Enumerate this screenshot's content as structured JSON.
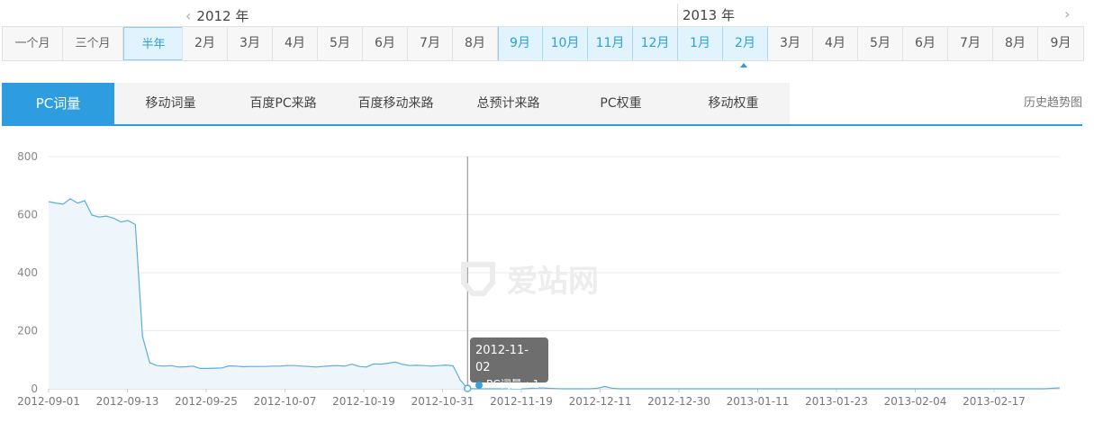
{
  "range_buttons": [
    {
      "label": "一个月",
      "active": false
    },
    {
      "label": "三个月",
      "active": false
    },
    {
      "label": "半年",
      "active": true
    }
  ],
  "years": {
    "prev": "2012 年",
    "next": "2013 年"
  },
  "months": [
    {
      "label": "2月",
      "sel": false
    },
    {
      "label": "3月",
      "sel": false
    },
    {
      "label": "4月",
      "sel": false
    },
    {
      "label": "5月",
      "sel": false
    },
    {
      "label": "6月",
      "sel": false
    },
    {
      "label": "7月",
      "sel": false
    },
    {
      "label": "8月",
      "sel": false
    },
    {
      "label": "9月",
      "sel": true
    },
    {
      "label": "10月",
      "sel": true
    },
    {
      "label": "11月",
      "sel": true
    },
    {
      "label": "12月",
      "sel": true
    },
    {
      "label": "1月",
      "sel": true
    },
    {
      "label": "2月",
      "sel": true
    },
    {
      "label": "3月",
      "sel": false
    },
    {
      "label": "4月",
      "sel": false
    },
    {
      "label": "5月",
      "sel": false
    },
    {
      "label": "6月",
      "sel": false
    },
    {
      "label": "7月",
      "sel": false
    },
    {
      "label": "8月",
      "sel": false
    },
    {
      "label": "9月",
      "sel": false
    }
  ],
  "tabs": [
    {
      "label": "PC词量",
      "active": true
    },
    {
      "label": "移动词量",
      "active": false
    },
    {
      "label": "百度PC来路",
      "active": false
    },
    {
      "label": "百度移动来路",
      "active": false
    },
    {
      "label": "总预计来路",
      "active": false
    },
    {
      "label": "PC权重",
      "active": false
    },
    {
      "label": "移动权重",
      "active": false
    }
  ],
  "history_link": "历史趋势图",
  "watermark": "爱站网",
  "tooltip": {
    "date": "2012-11-02",
    "series": "PC词量",
    "value": "1"
  },
  "colors": {
    "accent": "#2e9de0",
    "line": "#5aaee0",
    "area": "#eef5fb",
    "grid": "#ebebeb"
  },
  "chart_data": {
    "type": "area",
    "ylim": [
      0,
      800
    ],
    "yticks": [
      0,
      200,
      400,
      600,
      800
    ],
    "xticks": [
      "2012-09-01",
      "2012-09-13",
      "2012-09-25",
      "2012-10-07",
      "2012-10-19",
      "2012-10-31",
      "2012-11-19",
      "2012-12-11",
      "2012-12-30",
      "2013-01-11",
      "2013-01-23",
      "2013-02-04",
      "2013-02-17"
    ],
    "series": [
      {
        "name": "PC词量",
        "values": [
          645,
          640,
          636,
          655,
          640,
          648,
          598,
          592,
          595,
          588,
          575,
          580,
          566,
          180,
          90,
          80,
          78,
          80,
          75,
          76,
          78,
          70,
          70,
          71,
          72,
          79,
          78,
          76,
          77,
          77,
          77,
          78,
          78,
          80,
          80,
          78,
          77,
          75,
          77,
          79,
          80,
          78,
          85,
          77,
          75,
          86,
          85,
          88,
          92,
          84,
          80,
          81,
          80,
          78,
          80,
          82,
          79,
          30,
          1,
          0,
          0,
          0,
          0,
          0,
          0,
          0,
          0,
          2,
          3,
          2,
          1,
          0,
          0,
          0,
          0,
          0,
          2,
          8,
          2,
          0,
          0,
          0,
          0,
          0,
          0,
          0,
          0,
          0,
          0,
          0,
          0,
          0,
          0,
          0,
          0,
          0,
          0,
          0,
          0,
          0,
          0,
          0,
          0,
          0,
          0,
          0,
          0,
          0,
          0,
          0,
          0,
          0,
          0,
          0,
          0,
          0,
          0,
          0,
          0,
          0,
          0,
          0,
          0,
          0,
          0,
          0,
          0,
          0,
          0,
          0,
          0,
          0,
          0,
          0,
          0,
          0,
          0,
          0,
          0,
          2,
          3
        ]
      }
    ],
    "highlight_index": 58
  }
}
